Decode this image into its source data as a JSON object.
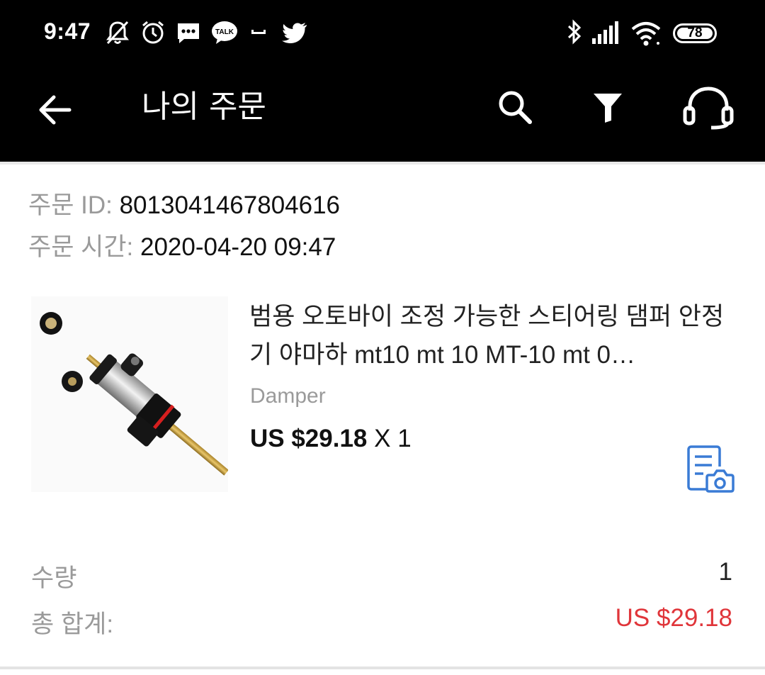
{
  "status_bar": {
    "time": "9:47",
    "notification_icons": [
      "mute-bell-icon",
      "alarm-icon",
      "sms-icon",
      "kakaotalk-icon",
      "minus-icon",
      "twitter-icon"
    ],
    "kakao_label": "TALK",
    "battery_level": "78",
    "system_icons": [
      "bluetooth-icon",
      "signal-icon",
      "wifi-icon",
      "battery-icon"
    ]
  },
  "app_bar": {
    "title": "나의 주문",
    "icons": [
      "back-arrow-icon",
      "search-icon",
      "filter-icon",
      "headset-icon"
    ]
  },
  "order": {
    "id_label": "주문 ID: ",
    "id_value": "8013041467804616",
    "time_label": "주문 시간: ",
    "time_value": "2020-04-20 09:47",
    "product": {
      "title": "범용 오토바이 조정 가능한 스티어링 댐퍼 안정기 야마하 mt10 mt 10 MT-10 mt 0…",
      "variant": "Damper",
      "price": "US $29.18",
      "quantity_suffix": " X 1"
    },
    "quantity_label": "수량",
    "quantity_value": "1",
    "total_label": "총 합계:",
    "total_value": "US $29.18"
  },
  "colors": {
    "bar_background": "#000000",
    "total_price": "#e0353a",
    "receipt_icon": "#3a7bd5",
    "muted_text": "#9a9a9a"
  }
}
